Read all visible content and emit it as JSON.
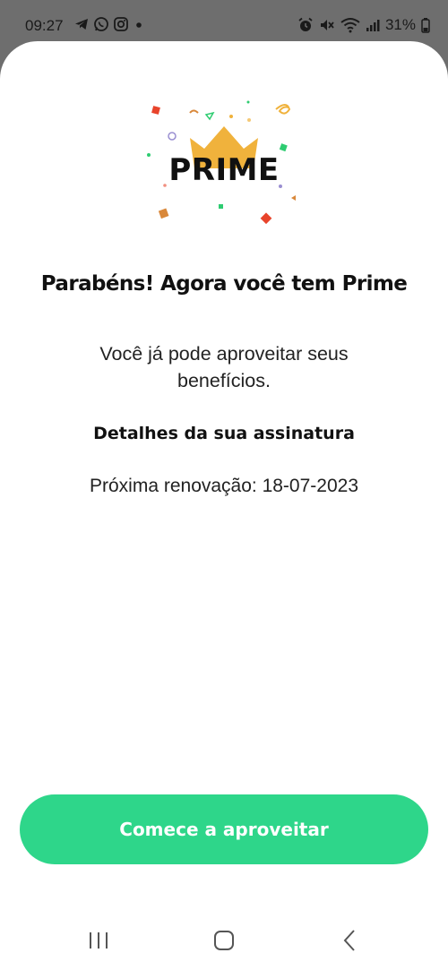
{
  "status_bar": {
    "time": "09:27",
    "battery_percent": "31%",
    "left_icons": [
      "telegram-icon",
      "whatsapp-icon",
      "instagram-icon",
      "notification-dot-icon"
    ],
    "right_icons": [
      "alarm-icon",
      "mute-icon",
      "wifi-icon",
      "signal-icon",
      "battery-icon"
    ]
  },
  "logo": {
    "word": "PRIME",
    "crown_color": "#f0b23c",
    "confetti_colors": [
      "#e8442b",
      "#2ecc71",
      "#f0b23c",
      "#9a8fd1",
      "#d9883a"
    ]
  },
  "content": {
    "title": "Parabéns! Agora você tem Prime",
    "subtitle": "Você já pode aproveitar seus benefícios.",
    "details_heading": "Detalhes da sua assinatura",
    "renewal_text": "Próxima renovação: 18-07-2023"
  },
  "cta": {
    "label": "Comece a aproveitar",
    "color": "#2ed68a"
  },
  "nav_bar": {
    "items": [
      "recent-apps-icon",
      "home-icon",
      "back-icon"
    ]
  }
}
